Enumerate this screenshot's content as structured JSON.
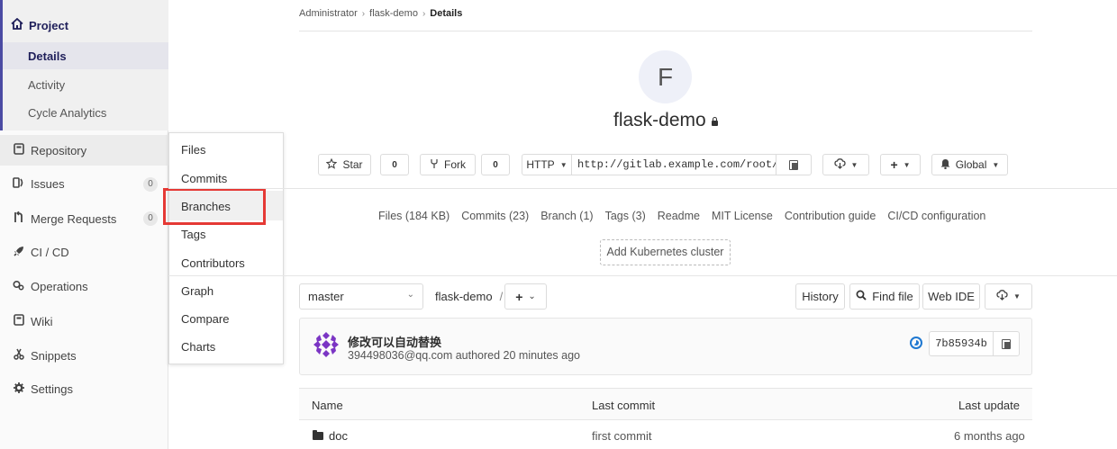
{
  "sidebar": {
    "project_label": "Project",
    "project_sub": [
      "Details",
      "Activity",
      "Cycle Analytics"
    ],
    "items": [
      {
        "label": "Repository",
        "icon": "book-icon"
      },
      {
        "label": "Issues",
        "icon": "issues-icon",
        "count": "0"
      },
      {
        "label": "Merge Requests",
        "icon": "merge-request-icon",
        "count": "0"
      },
      {
        "label": "CI / CD",
        "icon": "rocket-icon"
      },
      {
        "label": "Operations",
        "icon": "operations-icon"
      },
      {
        "label": "Wiki",
        "icon": "book-icon"
      },
      {
        "label": "Snippets",
        "icon": "scissors-icon"
      },
      {
        "label": "Settings",
        "icon": "gear-icon"
      }
    ]
  },
  "flyout": {
    "items": [
      "Files",
      "Commits",
      "Branches",
      "Tags",
      "Contributors",
      "Graph",
      "Compare",
      "Charts"
    ],
    "highlighted": "Branches",
    "highlight_color": "#e53935"
  },
  "breadcrumb": [
    "Administrator",
    "flask-demo",
    "Details"
  ],
  "project": {
    "avatar_letter": "F",
    "name": "flask-demo"
  },
  "actions": {
    "star_label": "Star",
    "star_count": "0",
    "fork_label": "Fork",
    "fork_count": "0",
    "protocol": "HTTP",
    "clone_url": "http://gitlab.example.com/root/flask-demo.git",
    "notification": "Global"
  },
  "stats": [
    "Files (184 KB)",
    "Commits (23)",
    "Branch (1)",
    "Tags (3)",
    "Readme",
    "MIT License",
    "Contribution guide",
    "CI/CD configuration"
  ],
  "k8s_button": "Add Kubernetes cluster",
  "repo_bar": {
    "branch": "master",
    "path": "flask-demo",
    "slash": "/",
    "add": "+",
    "history": "History",
    "find_file": "Find file",
    "web_ide": "Web IDE"
  },
  "last_commit": {
    "title": "修改可以自动替换",
    "meta": "394498036@qq.com authored 20 minutes ago",
    "sha": "7b85934b",
    "pipeline_color": "#1f78d1"
  },
  "table": {
    "headers": [
      "Name",
      "Last commit",
      "Last update"
    ],
    "rows": [
      {
        "name": "doc",
        "commit": "first commit",
        "updated": "6 months ago"
      }
    ]
  },
  "colors": {
    "accent": "#4b4ba3",
    "avatar_purple": "#7b35c4"
  }
}
